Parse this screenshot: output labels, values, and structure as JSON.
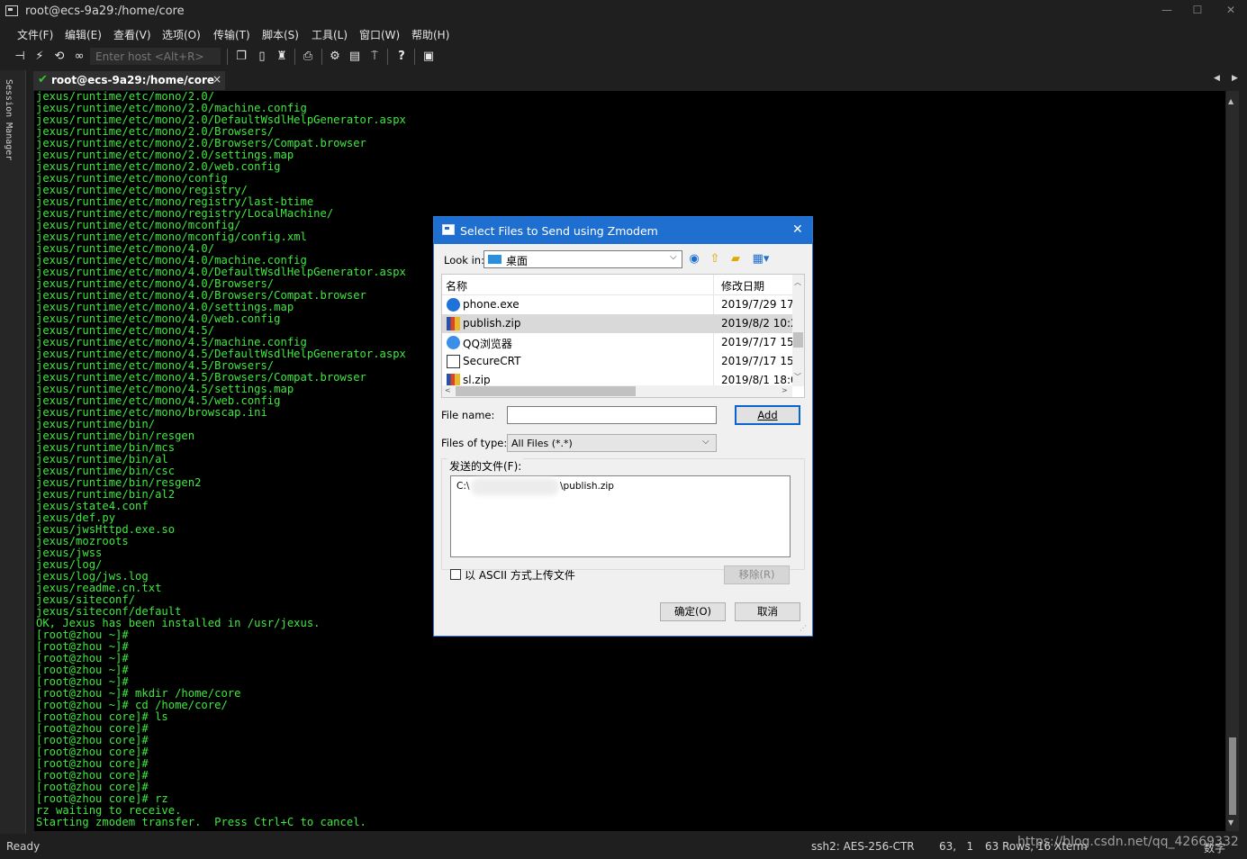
{
  "window": {
    "title": "root@ecs-9a29:/home/core",
    "controls": {
      "minimize": "—",
      "maximize": "☐",
      "close": "✕"
    }
  },
  "menu": [
    "文件(F)",
    "编辑(E)",
    "查看(V)",
    "选项(O)",
    "传输(T)",
    "脚本(S)",
    "工具(L)",
    "窗口(W)",
    "帮助(H)"
  ],
  "toolbar": {
    "host_placeholder": "Enter host <Alt+R>",
    "icons": [
      "connect-icon",
      "lightning-icon",
      "reconnect-icon",
      "link-icon",
      "copy-icon",
      "paste-icon",
      "find-icon",
      "print-icon",
      "settings-icon",
      "keymap-icon",
      "sftp-icon",
      "help-icon",
      "screen-icon"
    ]
  },
  "session_manager": {
    "label": "Session Manager"
  },
  "tab": {
    "label": "root@ecs-9a29:/home/core",
    "close": "×"
  },
  "terminal": {
    "lines": [
      "jexus/runtime/etc/mono/2.0/",
      "jexus/runtime/etc/mono/2.0/machine.config",
      "jexus/runtime/etc/mono/2.0/DefaultWsdlHelpGenerator.aspx",
      "jexus/runtime/etc/mono/2.0/Browsers/",
      "jexus/runtime/etc/mono/2.0/Browsers/Compat.browser",
      "jexus/runtime/etc/mono/2.0/settings.map",
      "jexus/runtime/etc/mono/2.0/web.config",
      "jexus/runtime/etc/mono/config",
      "jexus/runtime/etc/mono/registry/",
      "jexus/runtime/etc/mono/registry/last-btime",
      "jexus/runtime/etc/mono/registry/LocalMachine/",
      "jexus/runtime/etc/mono/mconfig/",
      "jexus/runtime/etc/mono/mconfig/config.xml",
      "jexus/runtime/etc/mono/4.0/",
      "jexus/runtime/etc/mono/4.0/machine.config",
      "jexus/runtime/etc/mono/4.0/DefaultWsdlHelpGenerator.aspx",
      "jexus/runtime/etc/mono/4.0/Browsers/",
      "jexus/runtime/etc/mono/4.0/Browsers/Compat.browser",
      "jexus/runtime/etc/mono/4.0/settings.map",
      "jexus/runtime/etc/mono/4.0/web.config",
      "jexus/runtime/etc/mono/4.5/",
      "jexus/runtime/etc/mono/4.5/machine.config",
      "jexus/runtime/etc/mono/4.5/DefaultWsdlHelpGenerator.aspx",
      "jexus/runtime/etc/mono/4.5/Browsers/",
      "jexus/runtime/etc/mono/4.5/Browsers/Compat.browser",
      "jexus/runtime/etc/mono/4.5/settings.map",
      "jexus/runtime/etc/mono/4.5/web.config",
      "jexus/runtime/etc/mono/browscap.ini",
      "jexus/runtime/bin/",
      "jexus/runtime/bin/resgen",
      "jexus/runtime/bin/mcs",
      "jexus/runtime/bin/al",
      "jexus/runtime/bin/csc",
      "jexus/runtime/bin/resgen2",
      "jexus/runtime/bin/al2",
      "jexus/state4.conf",
      "jexus/def.py",
      "jexus/jwsHttpd.exe.so",
      "jexus/mozroots",
      "jexus/jwss",
      "jexus/log/",
      "jexus/log/jws.log",
      "jexus/readme.cn.txt",
      "jexus/siteconf/",
      "jexus/siteconf/default",
      "OK, Jexus has been installed in /usr/jexus.",
      "[root@zhou ~]#",
      "[root@zhou ~]#",
      "[root@zhou ~]#",
      "[root@zhou ~]#",
      "[root@zhou ~]#",
      "[root@zhou ~]# mkdir /home/core",
      "[root@zhou ~]# cd /home/core/",
      "[root@zhou core]# ls",
      "[root@zhou core]#",
      "[root@zhou core]#",
      "[root@zhou core]#",
      "[root@zhou core]#",
      "[root@zhou core]#",
      "[root@zhou core]#",
      "[root@zhou core]# rz",
      "rz waiting to receive.",
      "Starting zmodem transfer.  Press Ctrl+C to cancel."
    ]
  },
  "status": {
    "ready": "Ready",
    "cipher": "ssh2: AES-256-CTR",
    "cursor": "63,   1",
    "size": "63 Rows, 16 Xterm",
    "numlock": "数字"
  },
  "watermark": "https://blog.csdn.net/qq_42669332",
  "dialog": {
    "title": "Select Files to Send using Zmodem",
    "close": "✕",
    "look_in_label": "Look in:",
    "look_in_value": "桌面",
    "columns": {
      "name": "名称",
      "date": "修改日期"
    },
    "files": [
      {
        "name": "phone.exe",
        "date": "2019/7/29 17:",
        "icon": "app-icon"
      },
      {
        "name": "publish.zip",
        "date": "2019/8/2 10:2",
        "icon": "zip-icon",
        "selected": true
      },
      {
        "name": "QQ浏览器",
        "date": "2019/7/17 15:",
        "icon": "browser-icon"
      },
      {
        "name": "SecureCRT",
        "date": "2019/7/17 15:",
        "icon": "securecrt-icon"
      },
      {
        "name": "sl.zip",
        "date": "2019/8/1 18:0",
        "icon": "zip-icon"
      }
    ],
    "file_name_label": "File name:",
    "file_name_value": "",
    "add_button": "Add",
    "file_type_label": "Files of type:",
    "file_type_value": "All Files (*.*)",
    "send_group_label": "发送的文件(F):",
    "send_path_prefix": "C:\\",
    "send_path_suffix": "\\publish.zip",
    "ascii_label": "以 ASCII 方式上传文件",
    "remove_button": "移除(R)",
    "ok_button": "确定(O)",
    "cancel_button": "取消"
  }
}
